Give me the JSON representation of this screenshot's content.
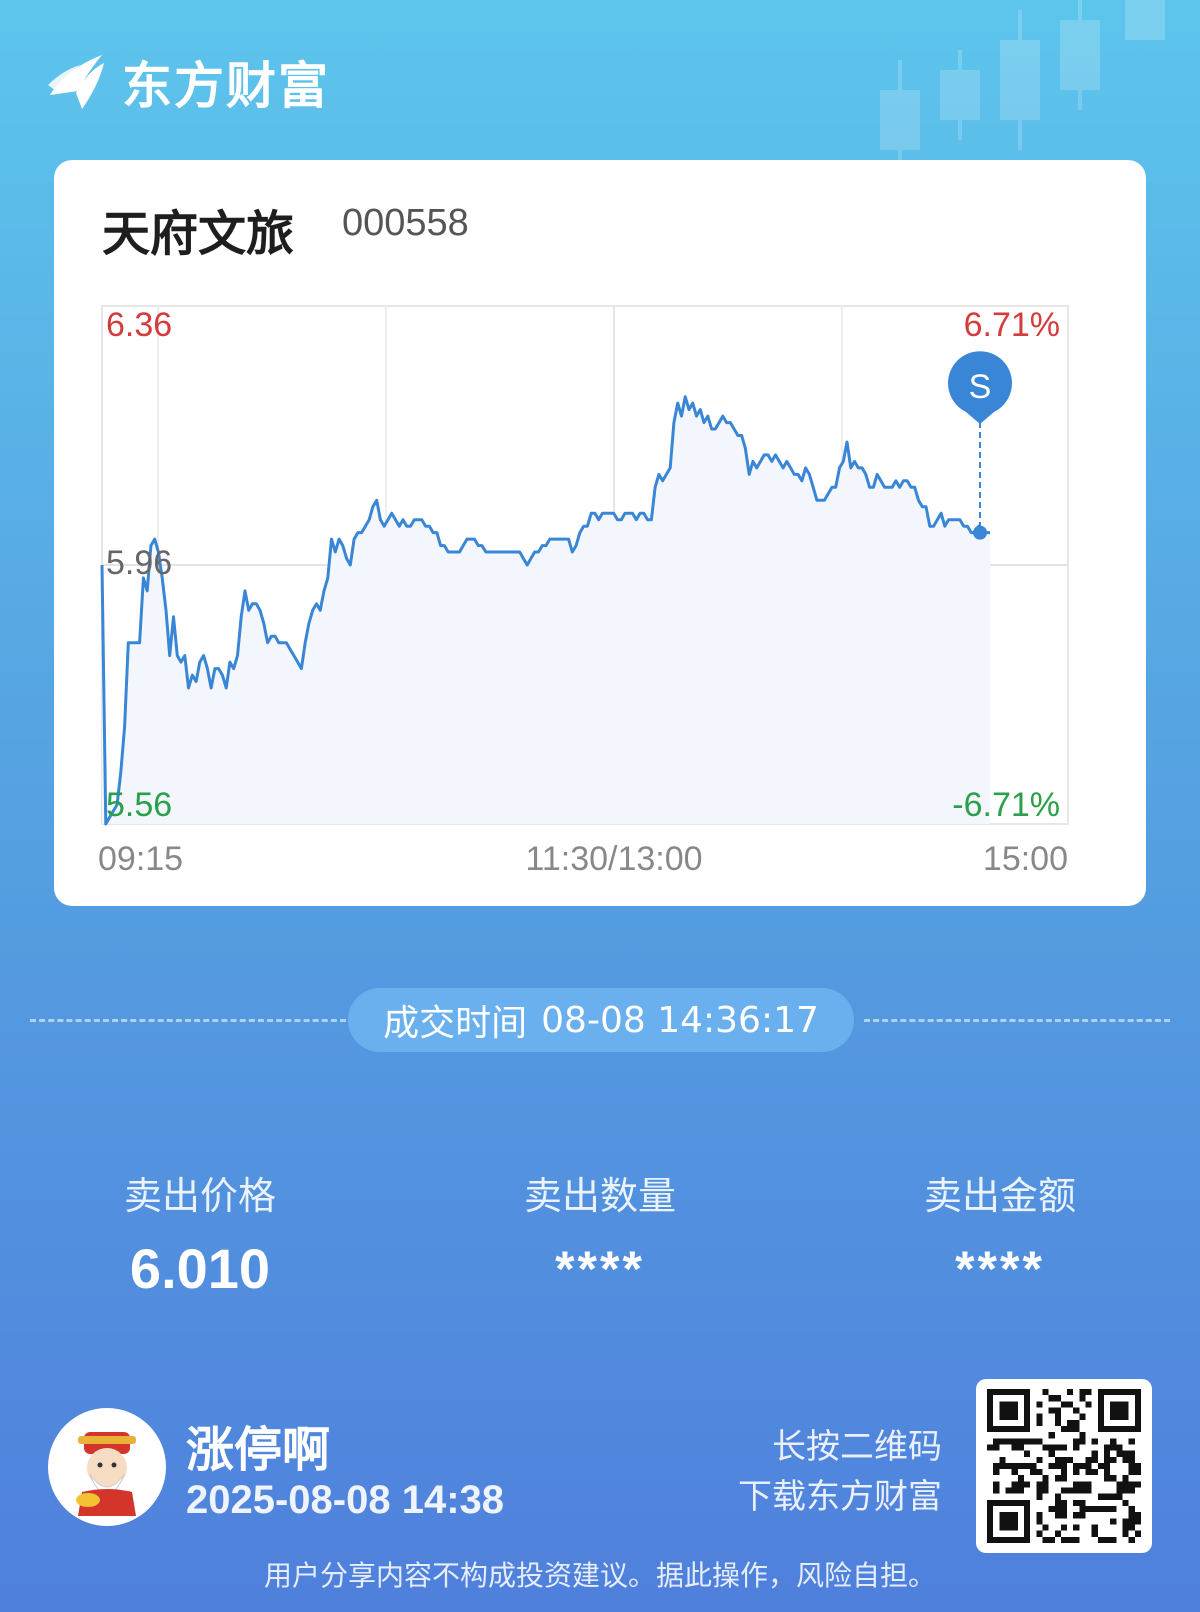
{
  "brand": {
    "name": "东方财富",
    "logo_icon": "eastmoney-logo-icon"
  },
  "stock": {
    "name": "天府文旅",
    "code": "000558"
  },
  "chart_data": {
    "type": "line",
    "price_max_label": "6.36",
    "price_mid_label": "5.96",
    "price_min_label": "5.56",
    "pct_max_label": "6.71%",
    "pct_min_label": "-6.71%",
    "x_labels": [
      "09:15",
      "11:30/13:00",
      "15:00"
    ],
    "ylim": [
      5.56,
      6.36
    ],
    "prev_close": 5.96,
    "grid": true,
    "marker": {
      "label": "S",
      "price": 6.01
    },
    "series": [
      {
        "color": "#3a86d6",
        "values": [
          5.96,
          5.56,
          5.57,
          5.58,
          5.59,
          5.64,
          5.71,
          5.84,
          5.84,
          5.84,
          5.84,
          5.94,
          5.92,
          5.99,
          6.0,
          5.98,
          5.94,
          5.89,
          5.82,
          5.88,
          5.82,
          5.81,
          5.82,
          5.77,
          5.79,
          5.78,
          5.81,
          5.82,
          5.8,
          5.77,
          5.8,
          5.8,
          5.79,
          5.77,
          5.81,
          5.8,
          5.82,
          5.88,
          5.92,
          5.89,
          5.9,
          5.9,
          5.89,
          5.87,
          5.84,
          5.85,
          5.85,
          5.84,
          5.84,
          5.84,
          5.83,
          5.82,
          5.81,
          5.8,
          5.84,
          5.87,
          5.89,
          5.9,
          5.89,
          5.92,
          5.94,
          6.0,
          5.98,
          6.0,
          5.99,
          5.97,
          5.96,
          6.0,
          6.01,
          6.01,
          6.02,
          6.03,
          6.05,
          6.06,
          6.03,
          6.02,
          6.03,
          6.04,
          6.03,
          6.02,
          6.03,
          6.02,
          6.02,
          6.03,
          6.03,
          6.03,
          6.02,
          6.02,
          6.01,
          6.01,
          5.99,
          5.99,
          5.98,
          5.98,
          5.98,
          5.98,
          5.99,
          6.0,
          6.0,
          6.0,
          5.99,
          5.99,
          5.98,
          5.98,
          5.98,
          5.98,
          5.98,
          5.98,
          5.98,
          5.98,
          5.98,
          5.98,
          5.97,
          5.96,
          5.97,
          5.98,
          5.98,
          5.99,
          5.99,
          6.0,
          6.0,
          6.0,
          6.0,
          6.0,
          6.0,
          5.98,
          5.99,
          6.01,
          6.02,
          6.02,
          6.04,
          6.04,
          6.03,
          6.04,
          6.04,
          6.04,
          6.04,
          6.03,
          6.03,
          6.04,
          6.04,
          6.04,
          6.03,
          6.04,
          6.04,
          6.03,
          6.03,
          6.08,
          6.1,
          6.09,
          6.1,
          6.11,
          6.18,
          6.21,
          6.19,
          6.22,
          6.2,
          6.21,
          6.19,
          6.2,
          6.18,
          6.19,
          6.17,
          6.17,
          6.18,
          6.19,
          6.18,
          6.18,
          6.17,
          6.16,
          6.16,
          6.14,
          6.1,
          6.12,
          6.11,
          6.12,
          6.13,
          6.13,
          6.12,
          6.13,
          6.12,
          6.11,
          6.12,
          6.11,
          6.1,
          6.1,
          6.09,
          6.11,
          6.1,
          6.08,
          6.06,
          6.06,
          6.06,
          6.07,
          6.08,
          6.08,
          6.11,
          6.12,
          6.15,
          6.11,
          6.12,
          6.11,
          6.11,
          6.1,
          6.08,
          6.08,
          6.1,
          6.09,
          6.08,
          6.08,
          6.08,
          6.09,
          6.08,
          6.09,
          6.09,
          6.08,
          6.08,
          6.06,
          6.05,
          6.05,
          6.02,
          6.02,
          6.03,
          6.04,
          6.02,
          6.03,
          6.03,
          6.03,
          6.03,
          6.02,
          6.02,
          6.01,
          6.01,
          6.02,
          6.01,
          6.01,
          6.01
        ]
      }
    ]
  },
  "trade": {
    "time_label": "成交时间",
    "time_value": "08-08 14:36:17",
    "price_label": "卖出价格",
    "price_value": "6.010",
    "qty_label": "卖出数量",
    "qty_value": "****",
    "amount_label": "卖出金额",
    "amount_value": "****"
  },
  "user": {
    "name": "涨停啊",
    "share_time": "2025-08-08 14:38",
    "avatar_icon": "caishen-avatar-icon"
  },
  "qr": {
    "hint_line1": "长按二维码",
    "hint_line2": "下载东方财富",
    "icon": "qr-code-icon"
  },
  "disclaimer": "用户分享内容不构成投资建议。据此操作，风险自担。",
  "colors": {
    "up": "#d63b3b",
    "down": "#2aa04a",
    "line": "#3a86d6",
    "marker": "#3a86d6"
  }
}
